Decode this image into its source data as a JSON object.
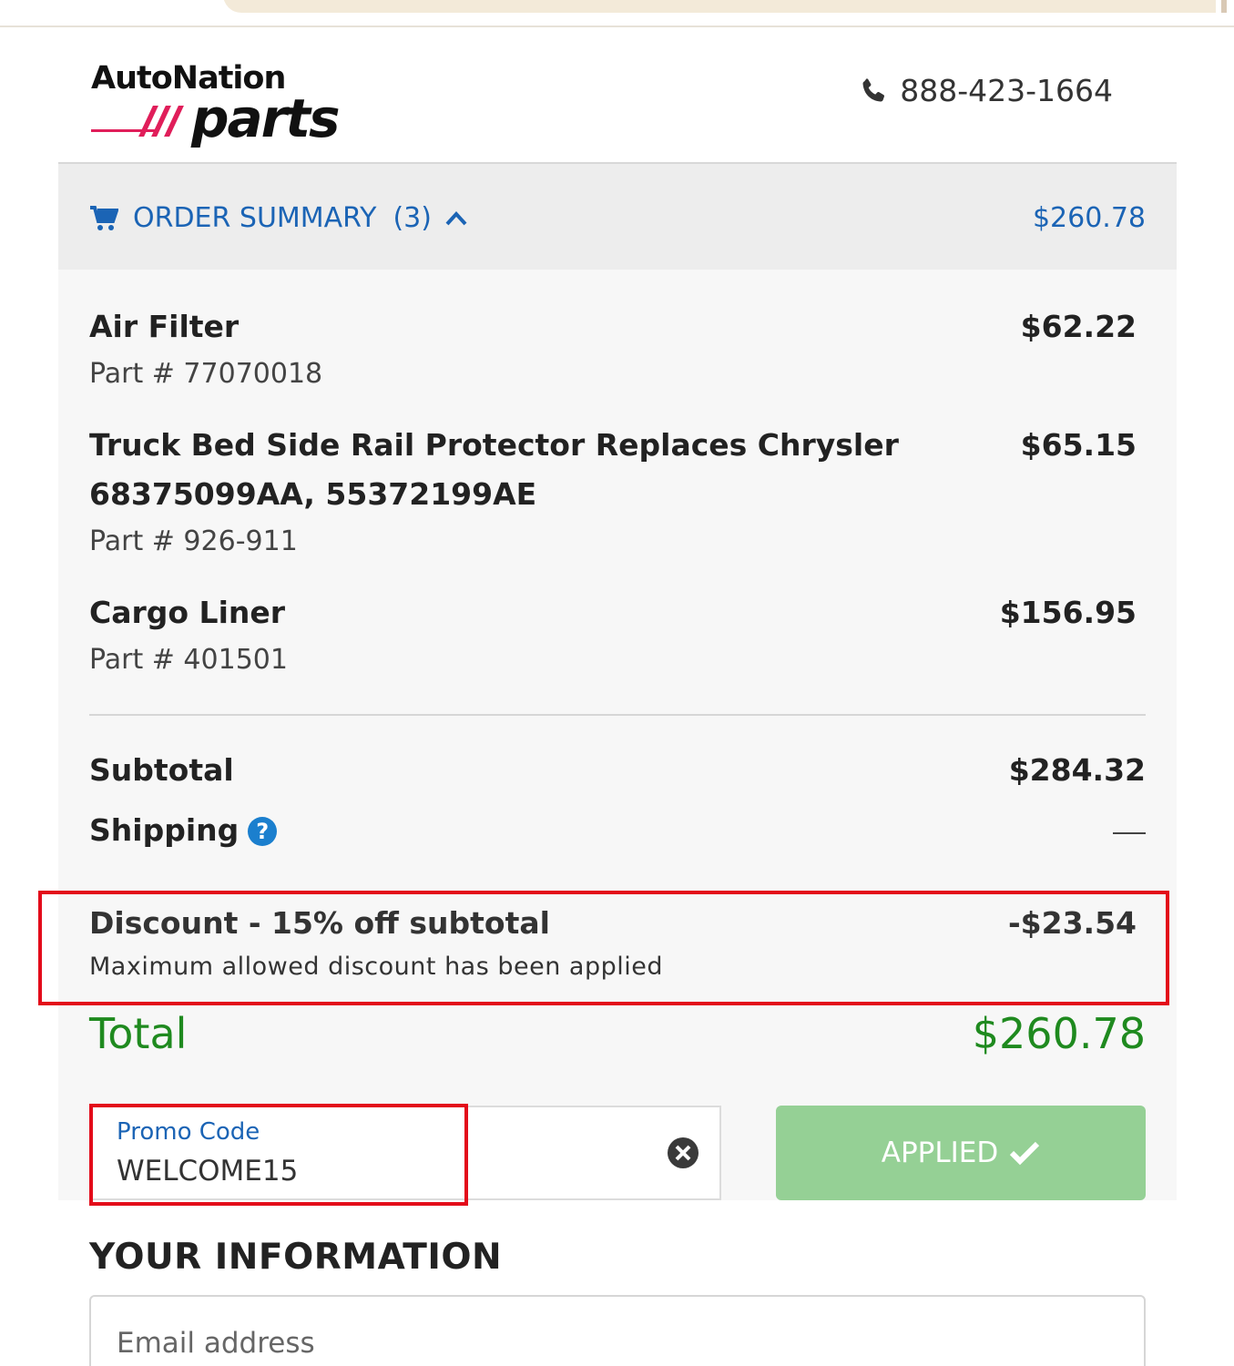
{
  "header": {
    "logo_brand": "AutoNation",
    "logo_parts": "parts",
    "phone": "888-423-1664"
  },
  "order_summary": {
    "title": "ORDER SUMMARY",
    "count": "(3)",
    "total": "$260.78",
    "items": [
      {
        "name": "Air Filter",
        "part": "Part # 77070018",
        "price": "$62.22"
      },
      {
        "name": "Truck Bed Side Rail Protector Replaces Chrysler 68375099AA, 55372199AE",
        "part": "Part # 926-911",
        "price": "$65.15"
      },
      {
        "name": "Cargo Liner",
        "part": "Part # 401501",
        "price": "$156.95"
      }
    ],
    "subtotal_label": "Subtotal",
    "subtotal_value": "$284.32",
    "shipping_label": "Shipping",
    "discount_label": "Discount - 15% off subtotal",
    "discount_value": "-$23.54",
    "discount_note": "Maximum allowed discount has been applied",
    "total_label": "Total",
    "total_value": "$260.78"
  },
  "promo": {
    "label": "Promo Code",
    "value": "WELCOME15",
    "button_label": "APPLIED"
  },
  "your_information": {
    "title": "YOUR INFORMATION",
    "email_placeholder": "Email address"
  },
  "colors": {
    "link_blue": "#1b64b5",
    "total_green": "#1f8a1f",
    "applied_green": "#95d095",
    "highlight_red": "#e30b1a"
  },
  "icons": [
    "phone-icon",
    "cart-icon",
    "chevron-up-icon",
    "help-icon",
    "clear-icon",
    "checkmark-icon"
  ]
}
